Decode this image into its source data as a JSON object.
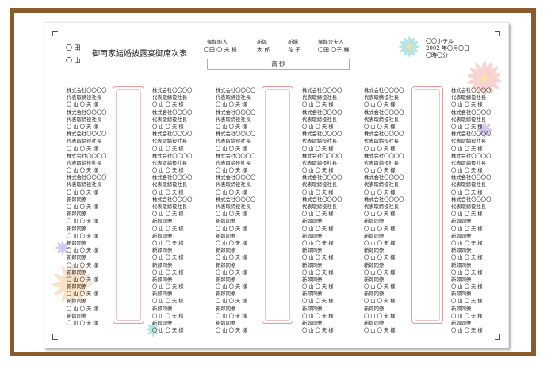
{
  "document": {
    "title": "御両家結婚披露宴御席次表",
    "families": [
      "〇 田",
      "〇 山"
    ],
    "header": {
      "labels": [
        "御媒酌人",
        "新郎",
        "新婦",
        "御媒介夫人"
      ],
      "values": [
        "〇田 〇 夫 様",
        "太 郎",
        "花 子",
        "〇田 〇子 様"
      ]
    },
    "head_table": "高 砂",
    "venue": [
      "〇〇ホテル",
      "2002 年〇月〇日",
      "〇時〇分"
    ],
    "columns": [
      [
        "株式会社〇〇〇〇",
        "代表取締役社長",
        "〇 山 〇 夫 様",
        "株式会社〇〇〇〇",
        "代表取締役社長",
        "〇 山 〇 夫 様",
        "株式会社〇〇〇〇",
        "代表取締役社長",
        "〇 山 〇 夫 様",
        "株式会社〇〇〇〇",
        "代表取締役社長",
        "〇 山 〇 夫 様",
        "株式会社〇〇〇〇",
        "代表取締役社長",
        "〇 山 〇 夫 様",
        "新郎同僚",
        "〇 山 〇 夫 様",
        "新郎同僚",
        "〇 山 〇 夫 様",
        "新郎同僚",
        "〇 山 〇 夫 様",
        "新郎同僚",
        "〇 山 〇 夫 様",
        "新郎同僚",
        "〇 山 〇 夫 様",
        "新郎同僚",
        "〇 山 〇 夫 様",
        "新郎同僚",
        "〇 山 〇 夫 様",
        "新郎同僚",
        "〇 山 〇 夫 様",
        "新郎同僚",
        "〇 山 〇 夫 様"
      ],
      [
        "株式会社〇〇〇〇",
        "代表取締役社長",
        "〇 山 〇 夫 様",
        "株式会社〇〇〇〇",
        "代表取締役社長",
        "〇 山 〇 夫 様",
        "株式会社〇〇〇〇",
        "代表取締役社長",
        "〇 山 〇 夫 様",
        "株式会社〇〇〇〇",
        "代表取締役社長",
        "〇 山 〇 夫 様",
        "株式会社〇〇〇〇",
        "代表取締役社長",
        "〇 山 〇 夫 様",
        "株式会社〇〇〇〇",
        "代表取締役社長",
        "〇 山 〇 夫 様",
        "新郎同僚",
        "〇 山 〇 夫 様",
        "新郎同僚",
        "〇 山 〇 夫 様",
        "新郎同僚",
        "〇 山 〇 夫 様",
        "新郎同僚",
        "〇 山 〇 夫 様",
        "新郎同僚",
        "〇 山 〇 夫 様",
        "新郎同僚",
        "〇 山 〇 夫 様",
        "新郎同僚",
        "〇 山 〇 夫 様",
        "新郎同僚",
        "〇 山 〇 夫 様"
      ],
      [
        "株式会社〇〇〇〇",
        "代表取締役社長",
        "〇 山 〇 夫 様",
        "株式会社〇〇〇〇",
        "代表取締役社長",
        "〇 山 〇 夫 様",
        "株式会社〇〇〇〇",
        "代表取締役社長",
        "〇 山 〇 夫 様",
        "株式会社〇〇〇〇",
        "代表取締役社長",
        "〇 山 〇 夫 様",
        "株式会社〇〇〇〇",
        "代表取締役社長",
        "〇 山 〇 夫 様",
        "株式会社〇〇〇〇",
        "代表取締役社長",
        "〇 山 〇 夫 様",
        "新郎同僚",
        "〇 山 〇 夫 様",
        "新郎同僚",
        "〇 山 〇 夫 様",
        "新郎同僚",
        "〇 山 〇 夫 様",
        "新郎同僚",
        "〇 山 〇 夫 様",
        "新郎同僚",
        "〇 山 〇 夫 様",
        "新郎同僚",
        "〇 山 〇 夫 様",
        "新郎同僚",
        "〇 山 〇 夫 様",
        "新郎同僚",
        "〇 山 〇 夫 様"
      ],
      [
        "株式会社〇〇〇〇",
        "代表取締役社長",
        "〇 山 〇 夫 様",
        "株式会社〇〇〇〇",
        "代表取締役社長",
        "〇 山 〇 夫 様",
        "株式会社〇〇〇〇",
        "代表取締役社長",
        "〇 山 〇 夫 様",
        "株式会社〇〇〇〇",
        "代表取締役社長",
        "〇 山 〇 夫 様",
        "株式会社〇〇〇〇",
        "代表取締役社長",
        "〇 山 〇 夫 様",
        "株式会社〇〇〇〇",
        "代表取締役社長",
        "〇 山 〇 夫 様",
        "新郎同僚",
        "〇 山 〇 夫 様",
        "新郎同僚",
        "〇 山 〇 夫 様",
        "新郎同僚",
        "〇 山 〇 夫 様",
        "新郎同僚",
        "〇 山 〇 夫 様",
        "新郎同僚",
        "〇 山 〇 夫 様",
        "新郎同僚",
        "〇 山 〇 夫 様",
        "新郎同僚",
        "〇 山 〇 夫 様",
        "新郎同僚",
        "〇 山 〇 夫 様"
      ],
      [
        "株式会社〇〇〇〇",
        "代表取締役社長",
        "〇 山 〇 夫 様",
        "株式会社〇〇〇〇",
        "代表取締役社長",
        "〇 山 〇 夫 様",
        "株式会社〇〇〇〇",
        "代表取締役社長",
        "〇 山 〇 夫 様",
        "株式会社〇〇〇〇",
        "代表取締役社長",
        "〇 山 〇 夫 様",
        "株式会社〇〇〇〇",
        "代表取締役社長",
        "〇 山 〇 夫 様",
        "株式会社〇〇〇〇",
        "代表取締役社長",
        "〇 山 〇 夫 様",
        "新郎同僚",
        "〇 山 〇 夫 様",
        "新郎同僚",
        "〇 山 〇 夫 様",
        "新郎同僚",
        "〇 山 〇 夫 様",
        "新郎同僚",
        "〇 山 〇 夫 様",
        "新郎同僚",
        "〇 山 〇 夫 様",
        "新郎同僚",
        "〇 山 〇 夫 様",
        "新郎同僚",
        "〇 山 〇 夫 様",
        "新郎同僚",
        "〇 山 〇 夫 様"
      ],
      [
        "株式会社〇〇〇〇",
        "代表取締役社長",
        "〇 山 〇 夫 様",
        "株式会社〇〇〇〇",
        "代表取締役社長",
        "〇 山 〇 夫 様",
        "株式会社〇〇〇〇",
        "代表取締役社長",
        "〇 山 〇 夫 様",
        "株式会社〇〇〇〇",
        "代表取締役社長",
        "〇 山 〇 夫 様",
        "株式会社〇〇〇〇",
        "代表取締役社長",
        "〇 山 〇 夫 様",
        "株式会社〇〇〇〇",
        "代表取締役社長",
        "〇 山 〇 夫 様",
        "新郎同僚",
        "〇 山 〇 夫 様",
        "新郎同僚",
        "〇 山 〇 夫 様",
        "新郎同僚",
        "〇 山 〇 夫 様",
        "新郎同僚",
        "〇 山 〇 夫 様",
        "新郎同僚",
        "〇 山 〇 夫 様",
        "新郎同僚",
        "〇 山 〇 夫 様",
        "新郎同僚",
        "〇 山 〇 夫 様",
        "新郎同僚",
        "〇 山 〇 夫 様"
      ]
    ],
    "colors": {
      "frame": "#8a5a2b",
      "table_border": "#e69a9a"
    }
  }
}
